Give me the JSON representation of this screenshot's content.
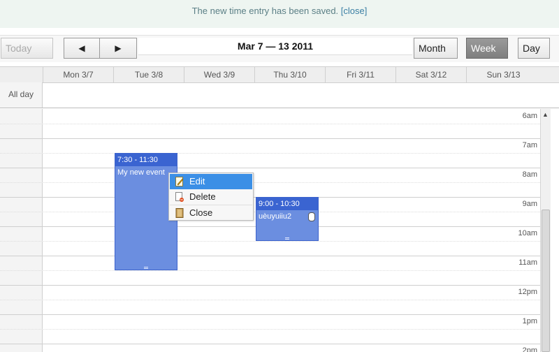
{
  "flash": {
    "message": "The new time entry has been saved.",
    "close_label": "[close]"
  },
  "toolbar": {
    "today_label": "Today",
    "prev_label": "◀",
    "next_label": "▶",
    "date_range": "Mar 7 — 13 2011",
    "month_label": "Month",
    "week_label": "Week",
    "day_label": "Day",
    "active_view": "Week"
  },
  "days": [
    "Mon 3/7",
    "Tue 3/8",
    "Wed 3/9",
    "Thu 3/10",
    "Fri 3/11",
    "Sat 3/12",
    "Sun 3/13"
  ],
  "allday_label": "All day",
  "hours": [
    "6am",
    "7am",
    "8am",
    "9am",
    "10am",
    "11am",
    "12pm",
    "1pm",
    "2pm"
  ],
  "events": [
    {
      "time": "7:30 - 11:30",
      "title": "My new event",
      "day": "Tue 3/8"
    },
    {
      "time": "9:00 - 10:30",
      "title": "uèuyuiiu2",
      "day": "Thu 3/10"
    }
  ],
  "context_menu": [
    {
      "label": "Edit",
      "icon": "edit-icon"
    },
    {
      "label": "Delete",
      "icon": "delete-icon"
    },
    {
      "label": "Close",
      "icon": "close-icon"
    }
  ],
  "colors": {
    "event_body": "#6b8ee0",
    "event_header": "#3a64d1",
    "menu_highlight": "#3b8fe6",
    "active_view": "#8a8a8a"
  }
}
